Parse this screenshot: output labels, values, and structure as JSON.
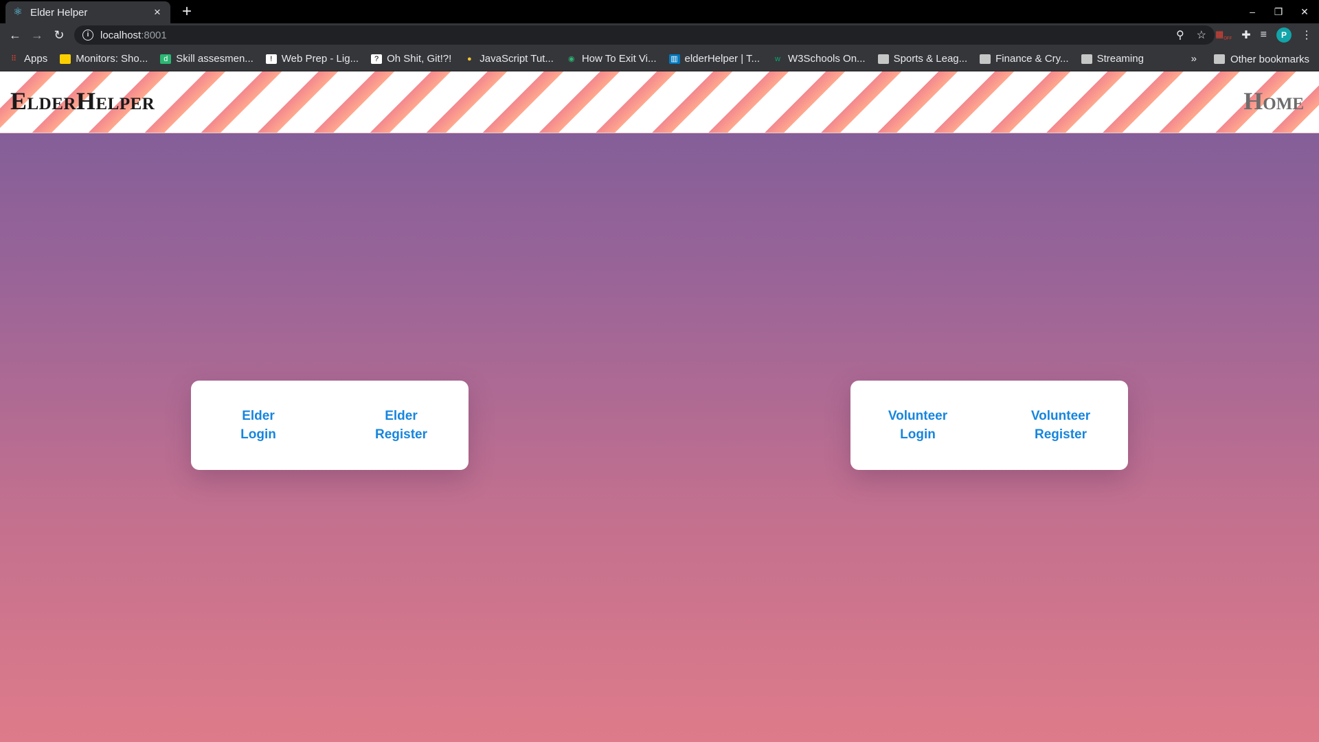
{
  "browser": {
    "tab_title": "Elder Helper",
    "new_tab": "+",
    "window_controls": [
      "–",
      "❐",
      "✕"
    ],
    "url_host": "localhost",
    "url_port": ":8001",
    "profile_initial": "P",
    "ext_off_label": "OFF"
  },
  "bookmarks": {
    "items": [
      {
        "label": "Apps",
        "icon": "apps-grid-icon"
      },
      {
        "label": "Monitors: Sho...",
        "icon": "tag-icon"
      },
      {
        "label": "Skill assesmen...",
        "icon": "d-icon"
      },
      {
        "label": "Web Prep - Lig...",
        "icon": "page-icon"
      },
      {
        "label": "Oh Shit, Git!?!",
        "icon": "git-icon"
      },
      {
        "label": "JavaScript Tut...",
        "icon": "python-icon"
      },
      {
        "label": "How To Exit Vi...",
        "icon": "site-icon"
      },
      {
        "label": "elderHelper | T...",
        "icon": "trello-icon"
      },
      {
        "label": "W3Schools On...",
        "icon": "w3-icon"
      },
      {
        "label": "Sports & Leag...",
        "icon": "folder-icon"
      },
      {
        "label": "Finance & Cry...",
        "icon": "folder-icon"
      },
      {
        "label": "Streaming",
        "icon": "folder-icon"
      }
    ],
    "more": "»",
    "other": "Other bookmarks"
  },
  "header": {
    "brand": "ElderHelper",
    "home": "Home"
  },
  "cards": {
    "elder": {
      "login_1": "Elder",
      "login_2": "Login",
      "register_1": "Elder",
      "register_2": "Register"
    },
    "volunteer": {
      "login_1": "Volunteer",
      "login_2": "Login",
      "register_1": "Volunteer",
      "register_2": "Register"
    }
  }
}
